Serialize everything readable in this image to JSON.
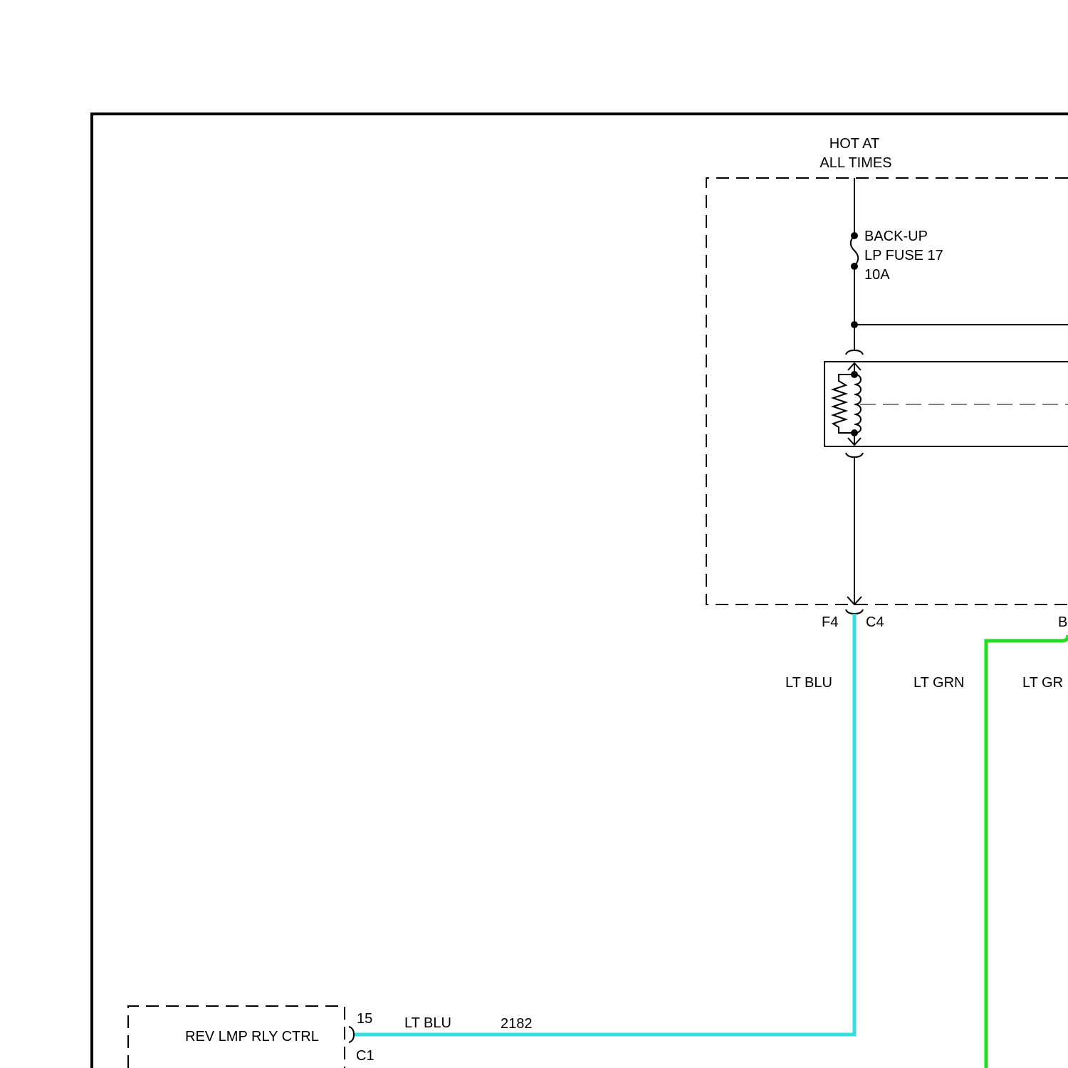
{
  "power_source": {
    "line1": "HOT AT",
    "line2": "ALL TIMES"
  },
  "fuse": {
    "line1": "BACK-UP",
    "line2": "LP FUSE 17",
    "line3": "10A"
  },
  "connector_left": {
    "pin": "F4",
    "connector": "C4"
  },
  "connector_right": {
    "pin_partial": "B"
  },
  "wires": {
    "blue_vertical_label": "LT BLU",
    "green_left_label": "LT GRN",
    "green_right_label_partial": "LT GR",
    "blue_horizontal_label": "LT BLU",
    "circuit_number": "2182"
  },
  "module": {
    "label": "REV LMP RLY CTRL",
    "pin": "15",
    "connector": "C1"
  },
  "colors": {
    "lt_blu_wire": "#33e0e0",
    "lt_grn_wire": "#22dd22",
    "line": "#000000",
    "background": "#ffffff"
  }
}
